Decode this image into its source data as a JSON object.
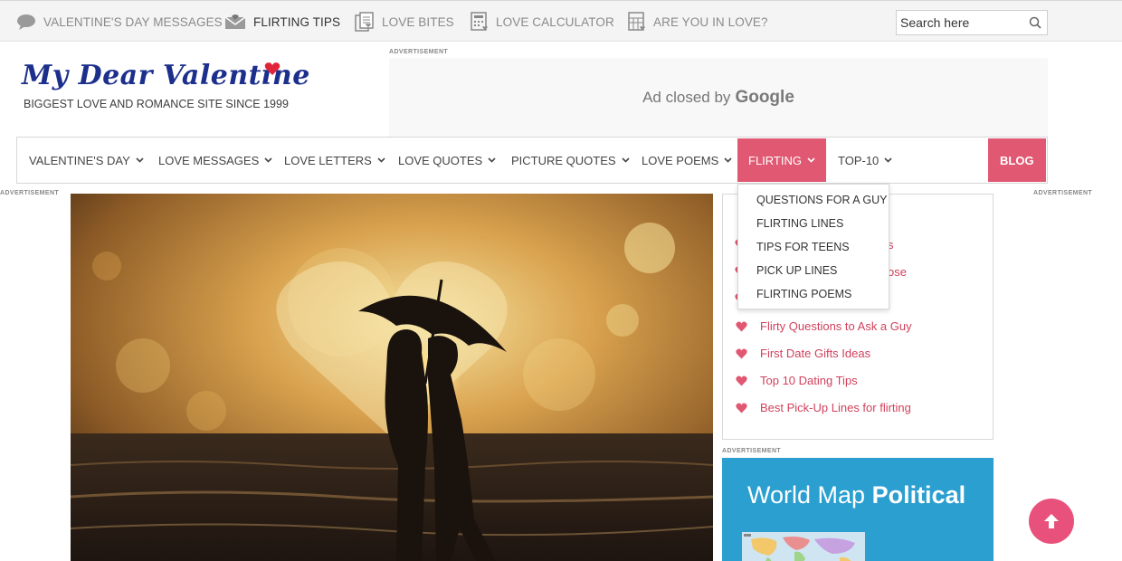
{
  "topbar": {
    "links": [
      {
        "label": "VALENTINE'S DAY MESSAGES",
        "icon": "speech-bubble-icon"
      },
      {
        "label": "FLIRTING TIPS",
        "icon": "envelope-icon"
      },
      {
        "label": "LOVE BITES",
        "icon": "document-icon"
      },
      {
        "label": "LOVE CALCULATOR",
        "icon": "calculator-icon"
      },
      {
        "label": "ARE YOU IN LOVE?",
        "icon": "calculator-heart-icon"
      }
    ],
    "search_placeholder": "Search here"
  },
  "logo": {
    "title": "My Dear Valentine",
    "tagline": "BIGGEST LOVE AND ROMANCE SITE SINCE 1999"
  },
  "ad": {
    "label": "ADVERTISEMENT",
    "closed_text": "Ad closed by",
    "brand": "Google"
  },
  "nav": {
    "items": [
      "VALENTINE'S DAY",
      "LOVE MESSAGES",
      "LOVE LETTERS",
      "LOVE QUOTES",
      "PICTURE QUOTES",
      "LOVE POEMS",
      "FLIRTING",
      "TOP-10"
    ],
    "blog": "BLOG",
    "active": "FLIRTING"
  },
  "dropdown": {
    "items": [
      "QUESTIONS FOR A GUY",
      "FLIRTING LINES",
      "TIPS FOR TEENS",
      "PICK UP LINES",
      "FLIRTING POEMS"
    ]
  },
  "side_labels": {
    "left": "ADVERTISEMENT",
    "right": "ADVERTISEMENT",
    "sidebar": "ADVERTISEMENT"
  },
  "sidebar": {
    "partial_links": [
      "s",
      "ose"
    ],
    "links": [
      "Flirty Questions to Ask a Guy",
      "First Date Gifts Ideas",
      "Top 10 Dating Tips",
      "Best Pick-Up Lines for flirting"
    ]
  },
  "map_ad": {
    "title_light": "World Map",
    "title_bold": "Political"
  },
  "colors": {
    "accent": "#e05872",
    "link": "#d0415c",
    "logo": "#1d2f8c",
    "map_ad": "#2b9fd0",
    "to_top": "#e8517b"
  }
}
